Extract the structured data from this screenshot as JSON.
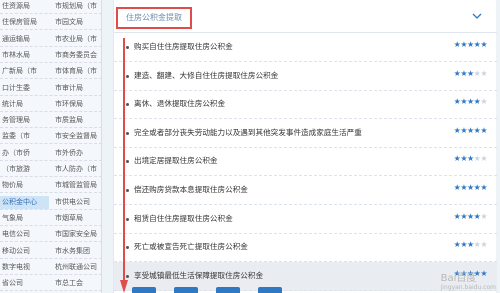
{
  "sidebar": {
    "rows": [
      {
        "left": "住资源局",
        "right": "市规划局（市",
        "active": null
      },
      {
        "left": "住保房管局",
        "right": "市园文局",
        "active": null
      },
      {
        "left": "通运输局",
        "right": "市农业局（市",
        "active": null
      },
      {
        "left": "市林水局",
        "right": "市商务委员会",
        "active": null
      },
      {
        "left": "广新局（市",
        "right": "市体育局（市",
        "active": null
      },
      {
        "left": "口计生委",
        "right": "市审计局",
        "active": null
      },
      {
        "left": "统计局",
        "right": "市环保局",
        "active": null
      },
      {
        "left": "务管理局",
        "right": "市质监局",
        "active": null
      },
      {
        "left": "监委（市",
        "right": "市安全监督局",
        "active": null
      },
      {
        "left": "办（市侨",
        "right": "市外侨办",
        "active": null
      },
      {
        "left": "（市旅游",
        "right": "市人防办（市",
        "active": null
      },
      {
        "left": "物价局",
        "right": "市城管监管局",
        "active": null
      },
      {
        "left": "公积金中心",
        "right": "市供电公司",
        "active": "left"
      },
      {
        "left": "气象局",
        "right": "市烟草局",
        "active": null
      },
      {
        "left": "电信公司",
        "right": "市国家安全局",
        "active": null
      },
      {
        "left": "移动公司",
        "right": "市水务集团",
        "active": null
      },
      {
        "left": "数字电视",
        "right": "杭州联通公司",
        "active": null
      },
      {
        "left": "省公司",
        "right": "市总工会",
        "active": null
      }
    ]
  },
  "main": {
    "tab_label": "住房公积金提取",
    "items": [
      {
        "label": "购买自住住房提取住房公积金",
        "stars": 5
      },
      {
        "label": "建造、翻建、大修自住住房提取住房公积金",
        "stars": 3
      },
      {
        "label": "离休、退休提取住房公积金",
        "stars": 4
      },
      {
        "label": "完全或者部分丧失劳动能力以及遇到其他突发事件造成家庭生活严重",
        "stars": 5
      },
      {
        "label": "出境定居提取住房公积金",
        "stars": 3
      },
      {
        "label": "偿还购房贷款本息提取住房公积金",
        "stars": 5
      },
      {
        "label": "租赁自住住房提取住房公积金",
        "stars": 4
      },
      {
        "label": "死亡或被宣告死亡提取住房公积金",
        "stars": 3
      },
      {
        "label": "享受城镇最低生活保障提取住房公积金",
        "stars": 5
      }
    ]
  },
  "watermark": {
    "text": "Bai百度",
    "sub": "jingyan.baidu.com"
  },
  "colors": {
    "accent": "#2f78c4",
    "annotation": "#e04b4b"
  }
}
